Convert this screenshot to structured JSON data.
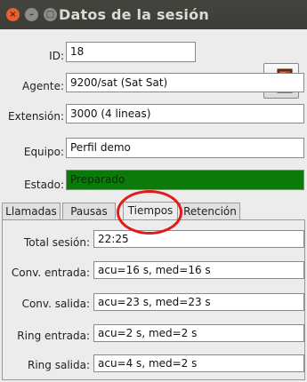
{
  "window": {
    "title": "Datos de la sesión",
    "close_glyph": "×",
    "min_glyph": "–",
    "max_glyph": "□"
  },
  "fields": {
    "id": {
      "label": "ID:",
      "value": "18"
    },
    "agente": {
      "label": "Agente:",
      "value": "9200/sat (Sat Sat)"
    },
    "extension": {
      "label": "Extensión:",
      "value": "3000 (4 lineas)"
    },
    "equipo": {
      "label": "Equipo:",
      "value": "Perfil demo"
    },
    "estado": {
      "label": "Estado:",
      "value": "Preparado",
      "color": "#0b7a0b"
    }
  },
  "exit_icon": "logout-door-icon",
  "tabs": [
    {
      "label": "Llamadas"
    },
    {
      "label": "Pausas"
    },
    {
      "label": "Tiempos",
      "active": true
    },
    {
      "label": "Retención"
    }
  ],
  "tiempos": {
    "total": {
      "label": "Total sesión:",
      "value": "22:25"
    },
    "conv_entrada": {
      "label": "Conv. entrada:",
      "value": "acu=16 s, med=16 s"
    },
    "conv_salida": {
      "label": "Conv. salida:",
      "value": "acu=23 s, med=23 s"
    },
    "ring_entrada": {
      "label": "Ring entrada:",
      "value": "acu=2 s, med=2 s"
    },
    "ring_salida": {
      "label": "Ring salida:",
      "value": "acu=4 s, med=2 s"
    }
  },
  "highlight_color": "#e41a1a"
}
